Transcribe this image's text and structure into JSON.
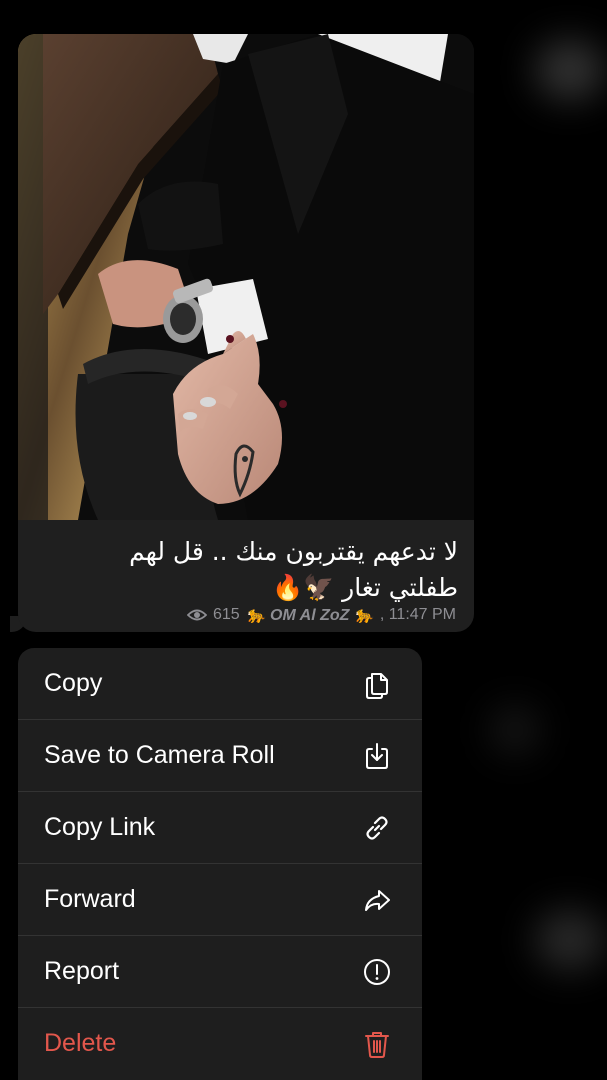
{
  "message": {
    "caption_lines": [
      "لا تدعهم يقتربون منك .. قل لهم",
      "طفلتي تغار 🦅🔥"
    ],
    "views": "615",
    "signature": "🐆 OM Al ZoZ 🐆",
    "time": ", 11:47 PM",
    "eye_icon": "eye-icon"
  },
  "menu": {
    "items": [
      {
        "label": "Copy",
        "icon": "copy-icon"
      },
      {
        "label": "Save to Camera Roll",
        "icon": "download-icon"
      },
      {
        "label": "Copy Link",
        "icon": "link-icon"
      },
      {
        "label": "Forward",
        "icon": "forward-icon"
      },
      {
        "label": "Report",
        "icon": "report-icon"
      },
      {
        "label": "Delete",
        "icon": "trash-icon"
      }
    ]
  },
  "colors": {
    "background": "#000000",
    "bubble": "#1f1f1f",
    "menu": "#1e1e1e",
    "separator": "#333333",
    "text": "#ffffff",
    "meta": "#8e8e93",
    "destructive": "#e2574c"
  }
}
